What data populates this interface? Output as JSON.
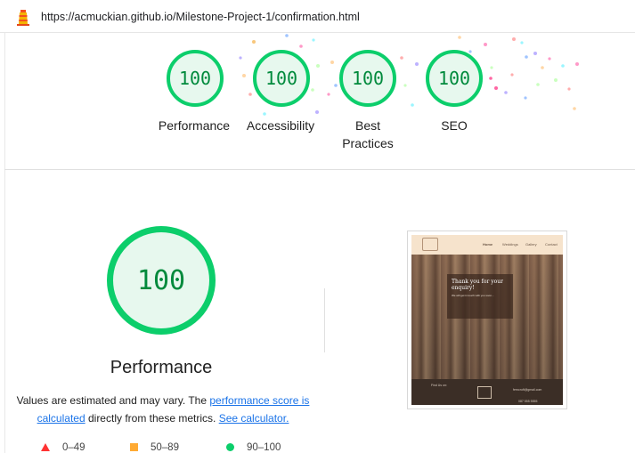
{
  "browser": {
    "url": "https://acmuckian.github.io/Milestone-Project-1/confirmation.html",
    "logo_icon": "lighthouse-icon"
  },
  "summary_gauges": [
    {
      "score": "100",
      "label": "Performance"
    },
    {
      "score": "100",
      "label": "Accessibility"
    },
    {
      "score": "100",
      "label": "Best Practices"
    },
    {
      "score": "100",
      "label": "SEO"
    }
  ],
  "performance": {
    "score": "100",
    "title": "Performance",
    "note_prefix": "Values are estimated and may vary. The ",
    "note_link": "performance score is calculated",
    "note_middle": " directly from these metrics. ",
    "note_calc_link": "See calculator."
  },
  "legend": [
    {
      "range": "0–49",
      "icon": "fail-triangle-icon",
      "color": "#ff3333"
    },
    {
      "range": "50–89",
      "icon": "average-square-icon",
      "color": "#ffaa33"
    },
    {
      "range": "90–100",
      "icon": "pass-circle-icon",
      "color": "#0cce6b"
    }
  ],
  "screenshot": {
    "nav_links": [
      "Home",
      "Weddings",
      "Gallery",
      "Contact"
    ],
    "card_title": "Thank you for your enquiry!",
    "card_subtitle": "We will get in touch with you soon...",
    "footer_left": "Find Us on:",
    "footer_email": "ferncroft@gmail.com",
    "footer_phone": "087 555 5555"
  },
  "colors": {
    "pass": "#0cce6b",
    "pass_text": "#008a3c",
    "pass_fill": "#e7f8ee",
    "link": "#1a73e8"
  }
}
